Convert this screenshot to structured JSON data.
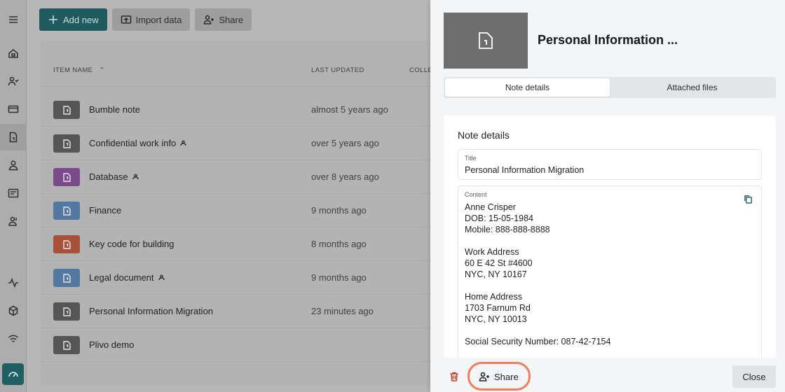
{
  "toolbar": {
    "add_new": "Add new",
    "import_data": "Import data",
    "share": "Share"
  },
  "table": {
    "col_item_name": "ITEM NAME",
    "col_last_updated": "LAST UPDATED",
    "col_collection": "COLLE",
    "rows": [
      {
        "name": "Bumble note",
        "updated": "almost 5 years ago",
        "color": "#555555",
        "shared": false
      },
      {
        "name": "Confidential work info",
        "updated": "over 5 years ago",
        "color": "#555555",
        "shared": true
      },
      {
        "name": "Database",
        "updated": "over 8 years ago",
        "color": "#7a4a8a",
        "shared": true
      },
      {
        "name": "Finance",
        "updated": "9 months ago",
        "color": "#5479a0",
        "shared": false
      },
      {
        "name": "Key code for building",
        "updated": "8 months ago",
        "color": "#a9503b",
        "shared": false
      },
      {
        "name": "Legal document",
        "updated": "9 months ago",
        "color": "#5479a0",
        "shared": true
      },
      {
        "name": "Personal Information Migration",
        "updated": "23 minutes ago",
        "color": "#555555",
        "shared": false
      },
      {
        "name": "Plivo demo",
        "updated": "",
        "color": "#555555",
        "shared": false
      }
    ]
  },
  "drawer": {
    "title": "Personal Information ...",
    "tabs": [
      "Note details",
      "Attached files"
    ],
    "section_heading": "Note details",
    "title_label": "Title",
    "title_value": "Personal Information Migration",
    "content_label": "Content",
    "content_lines": [
      "Anne Crisper",
      "DOB: 15-05-1984",
      "Mobile: 888-888-8888",
      "",
      "Work Address",
      "60 E 42 St #4600",
      "NYC, NY 10167",
      "",
      "Home Address",
      "1703 Farnum Rd",
      "NYC, NY 10013",
      "",
      "Social Security Number: 087-42-7154"
    ],
    "share_label": "Share",
    "close_label": "Close"
  },
  "colors": {
    "accent": "#1f5f64",
    "highlight_ring": "#ef7d5e",
    "danger": "#c8412f"
  }
}
